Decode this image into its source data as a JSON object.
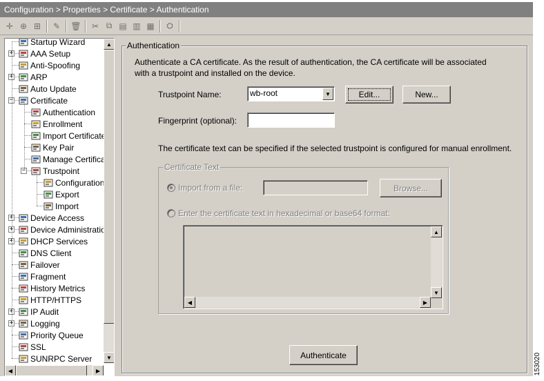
{
  "window": {
    "breadcrumb": "Configuration > Properties > Certificate > Authentication"
  },
  "toolbar": {
    "icons": [
      "add-icon",
      "insert-before-icon",
      "insert-after-icon",
      "edit-icon",
      "delete-icon",
      "cut-icon",
      "copy-icon",
      "paste-icon",
      "paste-before-icon",
      "paste-after-icon",
      "find-icon"
    ]
  },
  "tree": {
    "items": [
      {
        "label": "Startup Wizard",
        "icon": "wand-icon"
      },
      {
        "label": "AAA Setup",
        "icon": "aaa-icon"
      },
      {
        "label": "Anti-Spoofing",
        "icon": "anti-spoofing-icon"
      },
      {
        "label": "ARP",
        "icon": "arp-icon"
      },
      {
        "label": "Auto Update",
        "icon": "auto-update-icon"
      },
      {
        "label": "Certificate",
        "icon": "certificate-icon"
      },
      {
        "label": "Authentication",
        "icon": "authentication-icon"
      },
      {
        "label": "Enrollment",
        "icon": "enrollment-icon"
      },
      {
        "label": "Import Certificate",
        "icon": "import-certificate-icon"
      },
      {
        "label": "Key Pair",
        "icon": "key-pair-icon"
      },
      {
        "label": "Manage Certificates",
        "icon": "manage-certificates-icon"
      },
      {
        "label": "Trustpoint",
        "icon": "trustpoint-icon"
      },
      {
        "label": "Configuration",
        "icon": "configuration-icon"
      },
      {
        "label": "Export",
        "icon": "export-icon"
      },
      {
        "label": "Import",
        "icon": "import-icon"
      },
      {
        "label": "Device Access",
        "icon": "device-access-icon"
      },
      {
        "label": "Device Administration",
        "icon": "device-admin-icon"
      },
      {
        "label": "DHCP Services",
        "icon": "dhcp-icon"
      },
      {
        "label": "DNS Client",
        "icon": "dns-icon"
      },
      {
        "label": "Failover",
        "icon": "failover-icon"
      },
      {
        "label": "Fragment",
        "icon": "fragment-icon"
      },
      {
        "label": "History Metrics",
        "icon": "history-metrics-icon"
      },
      {
        "label": "HTTP/HTTPS",
        "icon": "http-icon"
      },
      {
        "label": "IP Audit",
        "icon": "ip-audit-icon"
      },
      {
        "label": "Logging",
        "icon": "logging-icon"
      },
      {
        "label": "Priority Queue",
        "icon": "priority-queue-icon"
      },
      {
        "label": "SSL",
        "icon": "ssl-icon"
      },
      {
        "label": "SUNRPC Server",
        "icon": "sunrpc-icon"
      }
    ]
  },
  "auth": {
    "group_title": "Authentication",
    "description_line1": "Authenticate a CA certificate.  As the result of authentication, the CA certificate will be associated",
    "description_line2": "with a trustpoint and installed on the device.",
    "trustpoint_label": "Trustpoint Name:",
    "trustpoint_value": "wb-root",
    "edit_button": "Edit...",
    "new_button": "New...",
    "fingerprint_label": "Fingerprint (optional):",
    "fingerprint_value": "",
    "manual_note": "The certificate text can be specified if the selected  trustpoint is configured for manual enrollment.",
    "cert_group_title": "Certificate Text",
    "import_file_label": "Import from a file:",
    "import_file_value": "",
    "browse_button": "Browse...",
    "enter_text_label": "Enter the certificate text in hexadecimal or base64 format:",
    "cert_text_value": "",
    "authenticate_button": "Authenticate"
  },
  "side_id": "153020"
}
